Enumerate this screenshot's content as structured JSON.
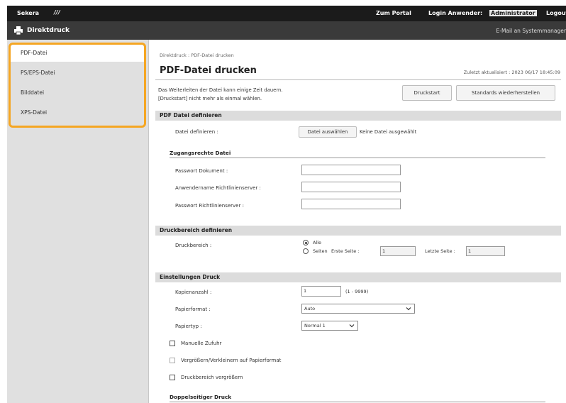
{
  "topbar": {
    "logo": "Sekera",
    "slashes": "///",
    "portal": "Zum Portal",
    "login": "Login Anwender:",
    "user": "Administrator",
    "logout": "Logout"
  },
  "appbar": {
    "title": "Direktdruck",
    "mail": "E-Mail an Systemmanager"
  },
  "sidebar": {
    "items": [
      {
        "label": "PDF-Datei"
      },
      {
        "label": "PS/EPS-Datei"
      },
      {
        "label": "Bilddatei"
      },
      {
        "label": "XPS-Datei"
      }
    ]
  },
  "main": {
    "breadcrumb": "Direktdruck : PDF-Datei drucken",
    "title": "PDF-Datei drucken",
    "updated": "Zuletzt aktualisiert : 2023 06/17 18:45:09",
    "info_line1": "Das Weiterleiten der Datei kann einige Zeit dauern.",
    "info_line2": "[Druckstart] nicht mehr als einmal wählen.",
    "btn_start": "Druckstart",
    "btn_defaults": "Standards wiederherstellen"
  },
  "pdf_define": {
    "section": "PDF Datei definieren",
    "file_label": "Datei definieren :",
    "choose_btn": "Datei auswählen",
    "no_file": "Keine Datei ausgewählt",
    "access_head": "Zugangsrechte Datei",
    "pwd_doc": "Passwort Dokument :",
    "user_policy": "Anwendername Richtlinienserver :",
    "pwd_policy": "Passwort Richtlinienserver :"
  },
  "print_range": {
    "section": "Druckbereich definieren",
    "label": "Druckbereich :",
    "all": "Alle",
    "pages": "Seiten",
    "first_label": "Erste Seite :",
    "first_val": "1",
    "last_label": "Letzte Seite :",
    "last_val": "1"
  },
  "print_settings": {
    "section": "Einstellungen Druck",
    "copies_label": "Kopienanzahl :",
    "copies_val": "1",
    "copies_range": "(1 - 9999)",
    "paper_format_label": "Papierformat :",
    "paper_format_val": "Auto",
    "paper_type_label": "Papiertyp :",
    "paper_type_val": "Normal 1",
    "manual_feed": "Manuelle Zufuhr",
    "enlarge_reduce": "Vergrößern/Verkleinern auf Papierformat",
    "enlarge_area": "Druckbereich vergrößern",
    "duplex_head": "Doppelseitiger Druck"
  }
}
